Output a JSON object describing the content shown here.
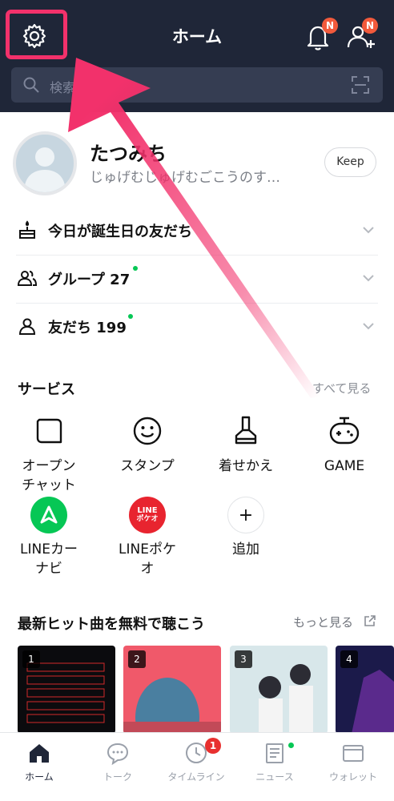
{
  "header": {
    "title": "ホーム",
    "bell_badge": "N",
    "friend_badge": "N",
    "search_placeholder": "検索"
  },
  "profile": {
    "name": "たつみち",
    "status": "じゅげむじゅげむごこうのす…",
    "keep_label": "Keep"
  },
  "rows": [
    {
      "label": "今日が誕生日の友だち",
      "icon": "cake-icon"
    },
    {
      "label": "グループ 27",
      "icon": "group-icon"
    },
    {
      "label": "友だち 199",
      "icon": "person-icon"
    }
  ],
  "services": {
    "title": "サービス",
    "see_all": "すべて見る",
    "items": [
      {
        "label": "オープン\nチャット",
        "icon": "open-chat-icon"
      },
      {
        "label": "スタンプ",
        "icon": "smiley-icon"
      },
      {
        "label": "着せかえ",
        "icon": "brush-icon"
      },
      {
        "label": "GAME",
        "icon": "gamepad-icon"
      },
      {
        "label": "LINEカー\nナビ",
        "icon": "line-car-navi-icon"
      },
      {
        "label": "LINEポケ\nオ",
        "icon": "line-pokeo-icon"
      },
      {
        "label": "追加",
        "icon": "plus-icon"
      }
    ],
    "pokeo_logo_top": "LINE",
    "pokeo_logo_bottom": "ポケオ"
  },
  "music": {
    "title": "最新ヒット曲を無料で聴こう",
    "more": "もっと見る",
    "albums": [
      {
        "rank": "1"
      },
      {
        "rank": "2"
      },
      {
        "rank": "3"
      },
      {
        "rank": "4"
      }
    ]
  },
  "bottom_nav": {
    "items": [
      {
        "label": "ホーム",
        "icon": "home-icon"
      },
      {
        "label": "トーク",
        "icon": "chat-bubble-icon"
      },
      {
        "label": "タイムライン",
        "icon": "clock-icon"
      },
      {
        "label": "ニュース",
        "icon": "news-icon"
      },
      {
        "label": "ウォレット",
        "icon": "wallet-icon"
      }
    ],
    "timeline_badge": "1"
  },
  "colors": {
    "header_bg": "#1f2638",
    "highlight": "#f2316b",
    "badge": "#f25a3c",
    "online_dot": "#06c755",
    "line_green": "#06c755"
  }
}
